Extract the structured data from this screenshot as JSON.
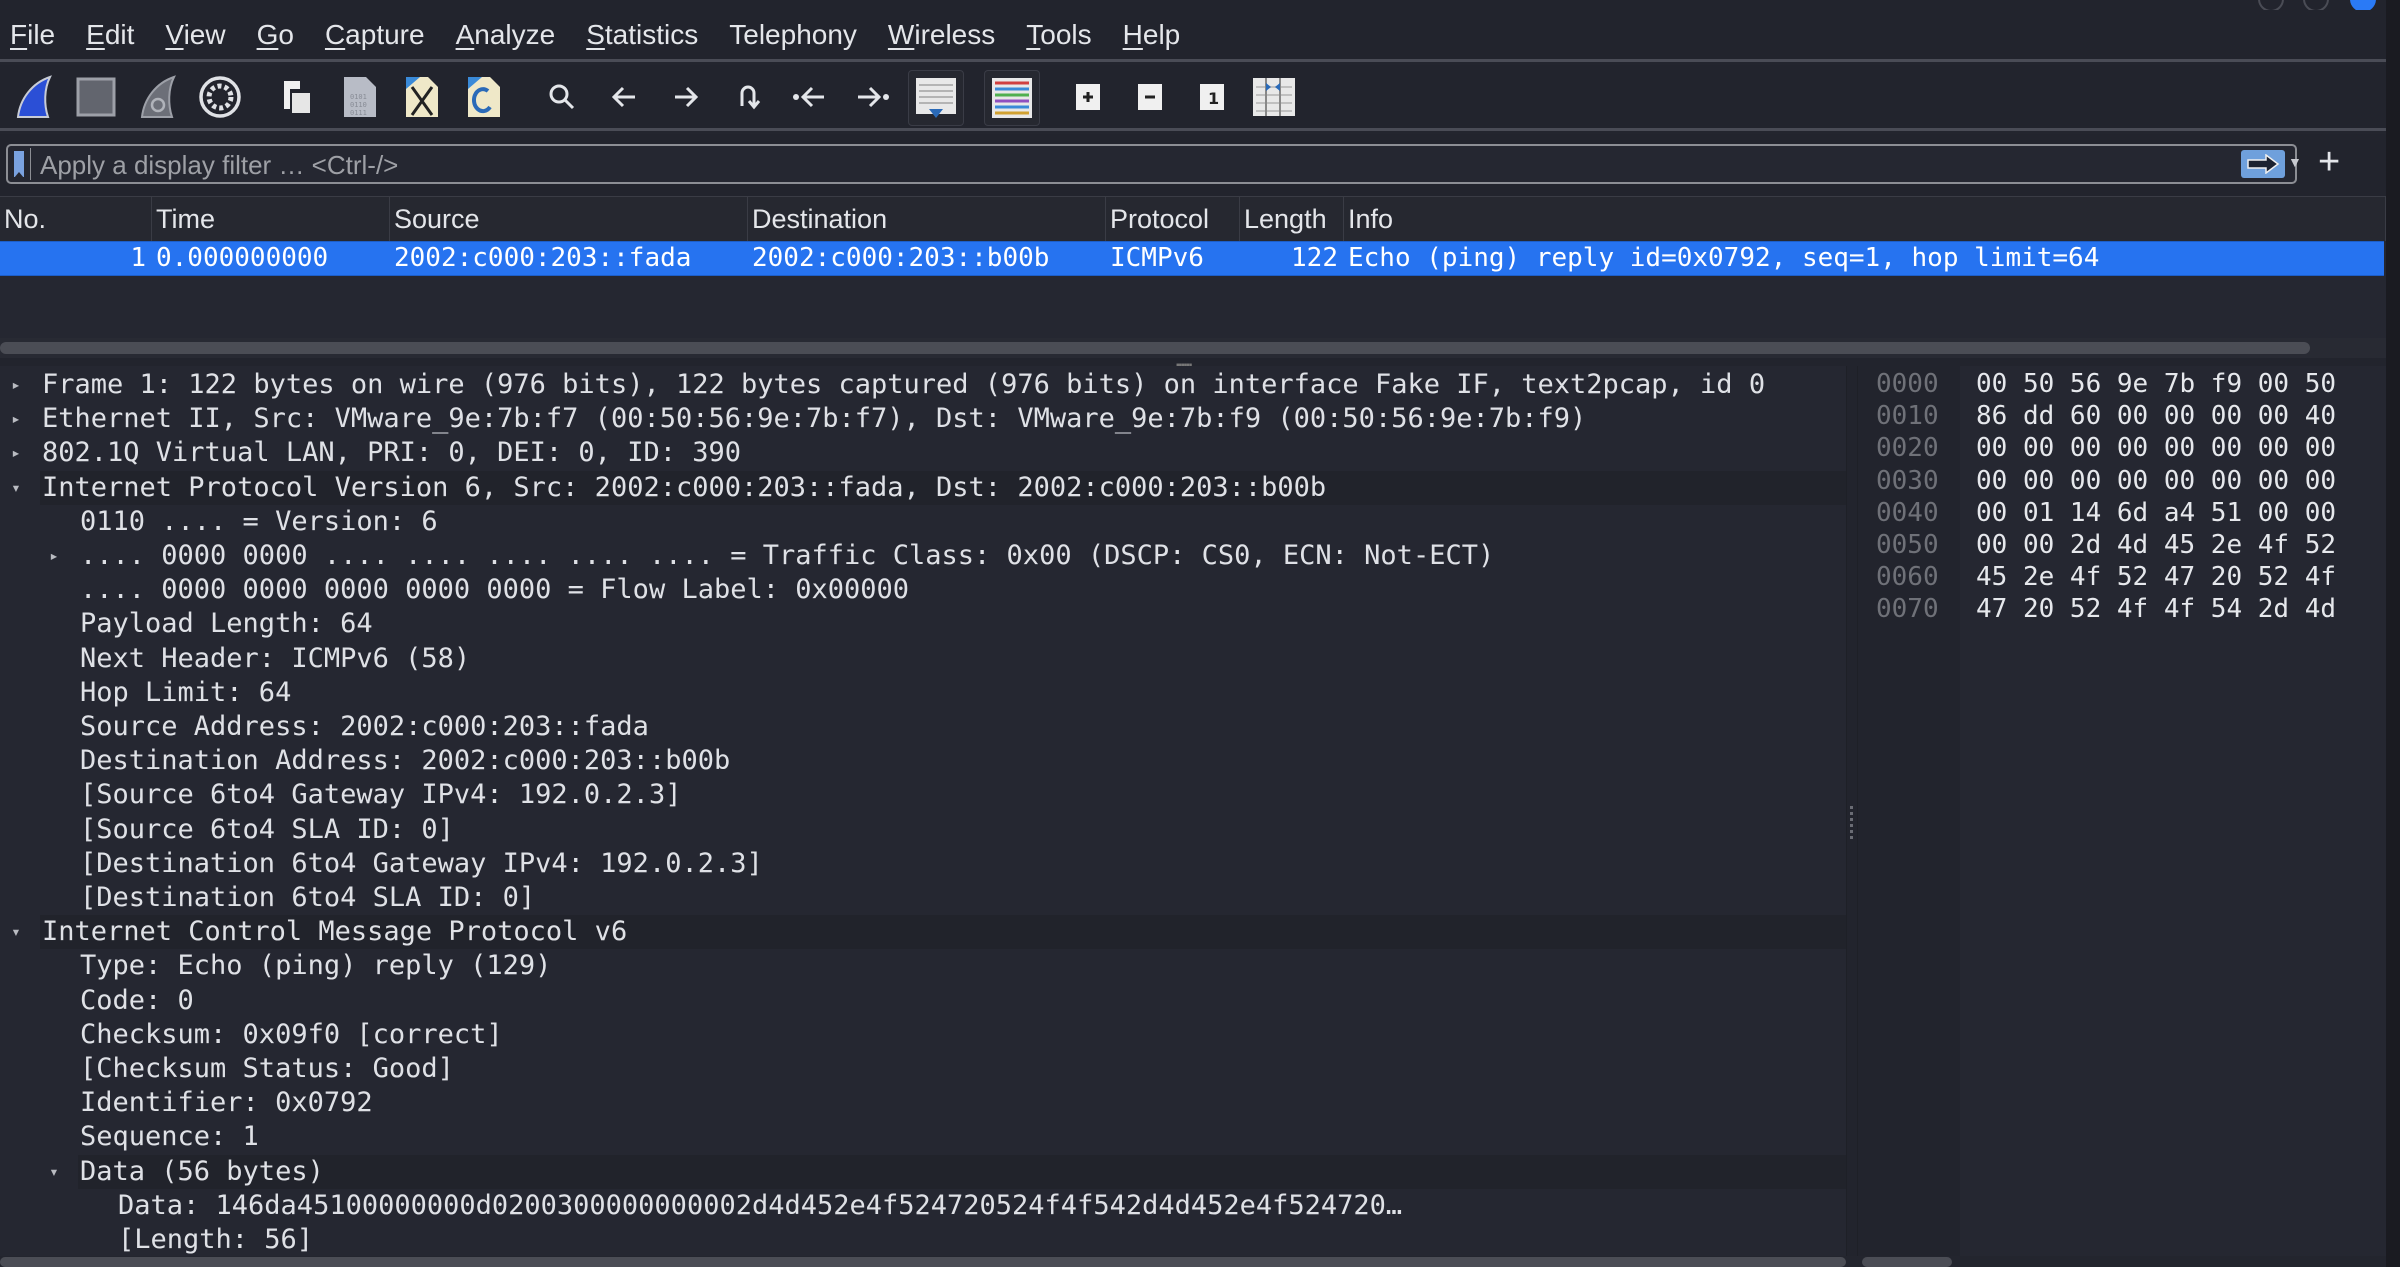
{
  "menu": [
    {
      "label": "File",
      "mnemonic": "F",
      "rest": "ile"
    },
    {
      "label": "Edit",
      "mnemonic": "E",
      "rest": "dit"
    },
    {
      "label": "View",
      "mnemonic": "V",
      "rest": "iew"
    },
    {
      "label": "Go",
      "mnemonic": "G",
      "rest": "o"
    },
    {
      "label": "Capture",
      "mnemonic": "C",
      "rest": "apture"
    },
    {
      "label": "Analyze",
      "mnemonic": "A",
      "rest": "nalyze"
    },
    {
      "label": "Statistics",
      "mnemonic": "S",
      "rest": "tatistics"
    },
    {
      "label": "Telephony",
      "mnemonic": "",
      "rest": "Telephony"
    },
    {
      "label": "Wireless",
      "mnemonic": "W",
      "rest": "ireless"
    },
    {
      "label": "Tools",
      "mnemonic": "T",
      "rest": "ools"
    },
    {
      "label": "Help",
      "mnemonic": "H",
      "rest": "elp"
    }
  ],
  "toolbar": [
    {
      "name": "start-capture",
      "icon": "shark-fin-blue"
    },
    {
      "name": "stop-capture",
      "icon": "stop-square"
    },
    {
      "name": "restart-capture",
      "icon": "shark-fin-restart"
    },
    {
      "name": "capture-options",
      "icon": "gear"
    },
    {
      "name": "open-file",
      "icon": "open-file"
    },
    {
      "name": "save-file",
      "icon": "file-binary"
    },
    {
      "name": "close-file",
      "icon": "file-close"
    },
    {
      "name": "reload-file",
      "icon": "file-reload"
    },
    {
      "name": "find-packet",
      "icon": "magnifier"
    },
    {
      "name": "go-back",
      "icon": "arrow-left"
    },
    {
      "name": "go-forward",
      "icon": "arrow-right"
    },
    {
      "name": "go-to-packet",
      "icon": "jump"
    },
    {
      "name": "go-first",
      "icon": "arrow-first"
    },
    {
      "name": "go-last",
      "icon": "arrow-last"
    },
    {
      "name": "autoscroll",
      "icon": "autoscroll"
    },
    {
      "name": "colorize",
      "icon": "colorize"
    },
    {
      "name": "zoom-in",
      "icon": "plus"
    },
    {
      "name": "zoom-out",
      "icon": "minus"
    },
    {
      "name": "normal-size",
      "icon": "one"
    },
    {
      "name": "resize-columns",
      "icon": "resize-columns"
    }
  ],
  "filter": {
    "placeholder": "Apply a display filter … <Ctrl-/>",
    "value": ""
  },
  "packet_list": {
    "columns": [
      "No.",
      "Time",
      "Source",
      "Destination",
      "Protocol",
      "Length",
      "Info"
    ],
    "rows": [
      {
        "no": "1",
        "time": "0.000000000",
        "source": "2002:c000:203::fada",
        "destination": "2002:c000:203::b00b",
        "protocol": "ICMPv6",
        "length": "122",
        "info": "Echo (ping) reply id=0x0792, seq=1, hop limit=64",
        "selected": true
      }
    ]
  },
  "details": [
    {
      "level": 0,
      "arrow": "collapsed",
      "text": "Frame 1: 122 bytes on wire (976 bits), 122 bytes captured (976 bits) on interface Fake IF, text2pcap, id 0"
    },
    {
      "level": 0,
      "arrow": "collapsed",
      "text": "Ethernet II, Src: VMware_9e:7b:f7 (00:50:56:9e:7b:f7), Dst: VMware_9e:7b:f9 (00:50:56:9e:7b:f9)"
    },
    {
      "level": 0,
      "arrow": "collapsed",
      "text": "802.1Q Virtual LAN, PRI: 0, DEI: 0, ID: 390"
    },
    {
      "level": 0,
      "arrow": "expanded",
      "text": "Internet Protocol Version 6, Src: 2002:c000:203::fada, Dst: 2002:c000:203::b00b",
      "highlight": true
    },
    {
      "level": 1,
      "arrow": "none",
      "text": "0110 .... = Version: 6"
    },
    {
      "level": 1,
      "arrow": "collapsed",
      "text": ".... 0000 0000 .... .... .... .... .... = Traffic Class: 0x00 (DSCP: CS0, ECN: Not-ECT)"
    },
    {
      "level": 1,
      "arrow": "none",
      "text": ".... 0000 0000 0000 0000 0000 = Flow Label: 0x00000"
    },
    {
      "level": 1,
      "arrow": "none",
      "text": "Payload Length: 64"
    },
    {
      "level": 1,
      "arrow": "none",
      "text": "Next Header: ICMPv6 (58)"
    },
    {
      "level": 1,
      "arrow": "none",
      "text": "Hop Limit: 64"
    },
    {
      "level": 1,
      "arrow": "none",
      "text": "Source Address: 2002:c000:203::fada"
    },
    {
      "level": 1,
      "arrow": "none",
      "text": "Destination Address: 2002:c000:203::b00b"
    },
    {
      "level": 1,
      "arrow": "none",
      "text": "[Source 6to4 Gateway IPv4: 192.0.2.3]"
    },
    {
      "level": 1,
      "arrow": "none",
      "text": "[Source 6to4 SLA ID: 0]"
    },
    {
      "level": 1,
      "arrow": "none",
      "text": "[Destination 6to4 Gateway IPv4: 192.0.2.3]"
    },
    {
      "level": 1,
      "arrow": "none",
      "text": "[Destination 6to4 SLA ID: 0]"
    },
    {
      "level": 0,
      "arrow": "expanded",
      "text": "Internet Control Message Protocol v6",
      "highlight": true
    },
    {
      "level": 1,
      "arrow": "none",
      "text": "Type: Echo (ping) reply (129)"
    },
    {
      "level": 1,
      "arrow": "none",
      "text": "Code: 0"
    },
    {
      "level": 1,
      "arrow": "none",
      "text": "Checksum: 0x09f0 [correct]"
    },
    {
      "level": 1,
      "arrow": "none",
      "text": "[Checksum Status: Good]"
    },
    {
      "level": 1,
      "arrow": "none",
      "text": "Identifier: 0x0792"
    },
    {
      "level": 1,
      "arrow": "none",
      "text": "Sequence: 1"
    },
    {
      "level": 1,
      "arrow": "expanded",
      "text": "Data (56 bytes)",
      "highlight": true
    },
    {
      "level": 2,
      "arrow": "none",
      "text": "Data: 146da45100000000d0200300000000002d4d452e4f524720524f4f542d4d452e4f524720…"
    },
    {
      "level": 2,
      "arrow": "none",
      "text": "[Length: 56]"
    }
  ],
  "hex": [
    {
      "offset": "0000",
      "bytes": "00 50 56 9e 7b f9 00 50"
    },
    {
      "offset": "0010",
      "bytes": "86 dd 60 00 00 00 00 40"
    },
    {
      "offset": "0020",
      "bytes": "00 00 00 00 00 00 00 00"
    },
    {
      "offset": "0030",
      "bytes": "00 00 00 00 00 00 00 00"
    },
    {
      "offset": "0040",
      "bytes": "00 01 14 6d a4 51 00 00"
    },
    {
      "offset": "0050",
      "bytes": "00 00 2d 4d 45 2e 4f 52"
    },
    {
      "offset": "0060",
      "bytes": "45 2e 4f 52 47 20 52 4f"
    },
    {
      "offset": "0070",
      "bytes": "47 20 52 4f 4f 54 2d 4d"
    }
  ],
  "colors": {
    "background": "#23252e",
    "selection": "#2673f0",
    "text": "#dfe1e6",
    "offset_text": "#6f7178"
  }
}
